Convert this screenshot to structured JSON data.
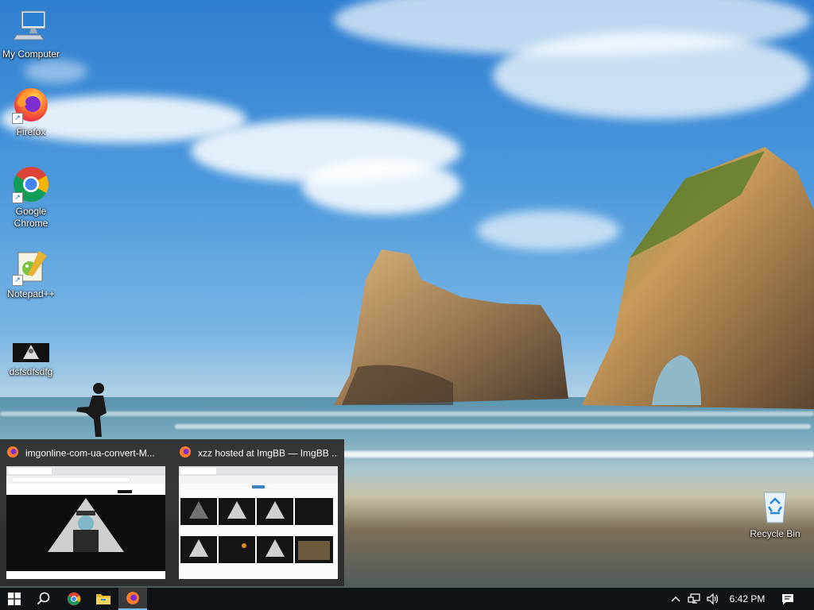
{
  "desktop": {
    "icons": [
      {
        "label": "My Computer",
        "icon": "computer-icon"
      },
      {
        "label": "Firefox",
        "icon": "firefox-icon"
      },
      {
        "label": "Google Chrome",
        "icon": "chrome-icon"
      },
      {
        "label": "Notepad++",
        "icon": "notepadpp-icon"
      },
      {
        "label": "dsfsdfsdfg",
        "icon": "image-file-icon"
      },
      {
        "label": "Recycle Bin",
        "icon": "recycle-bin-icon"
      }
    ]
  },
  "preview": {
    "windows": [
      {
        "title": "imgonline-com-ua-convert-M...",
        "icon": "firefox-icon"
      },
      {
        "title": "xzz hosted at ImgBB — ImgBB ...",
        "icon": "firefox-icon"
      }
    ]
  },
  "taskbar": {
    "start_icon": "windows-logo-icon",
    "search_icon": "search-icon",
    "pinned": [
      "chrome-icon",
      "file-explorer-icon",
      "firefox-icon"
    ],
    "tray": {
      "clock": "6:42 PM",
      "icons": [
        "chevron-up-icon",
        "network-icon",
        "volume-icon",
        "notification-icon"
      ]
    }
  },
  "colors": {
    "taskbar": "#101418",
    "accent": "#76b9ed",
    "preview_bg": "#2b2b2b"
  }
}
